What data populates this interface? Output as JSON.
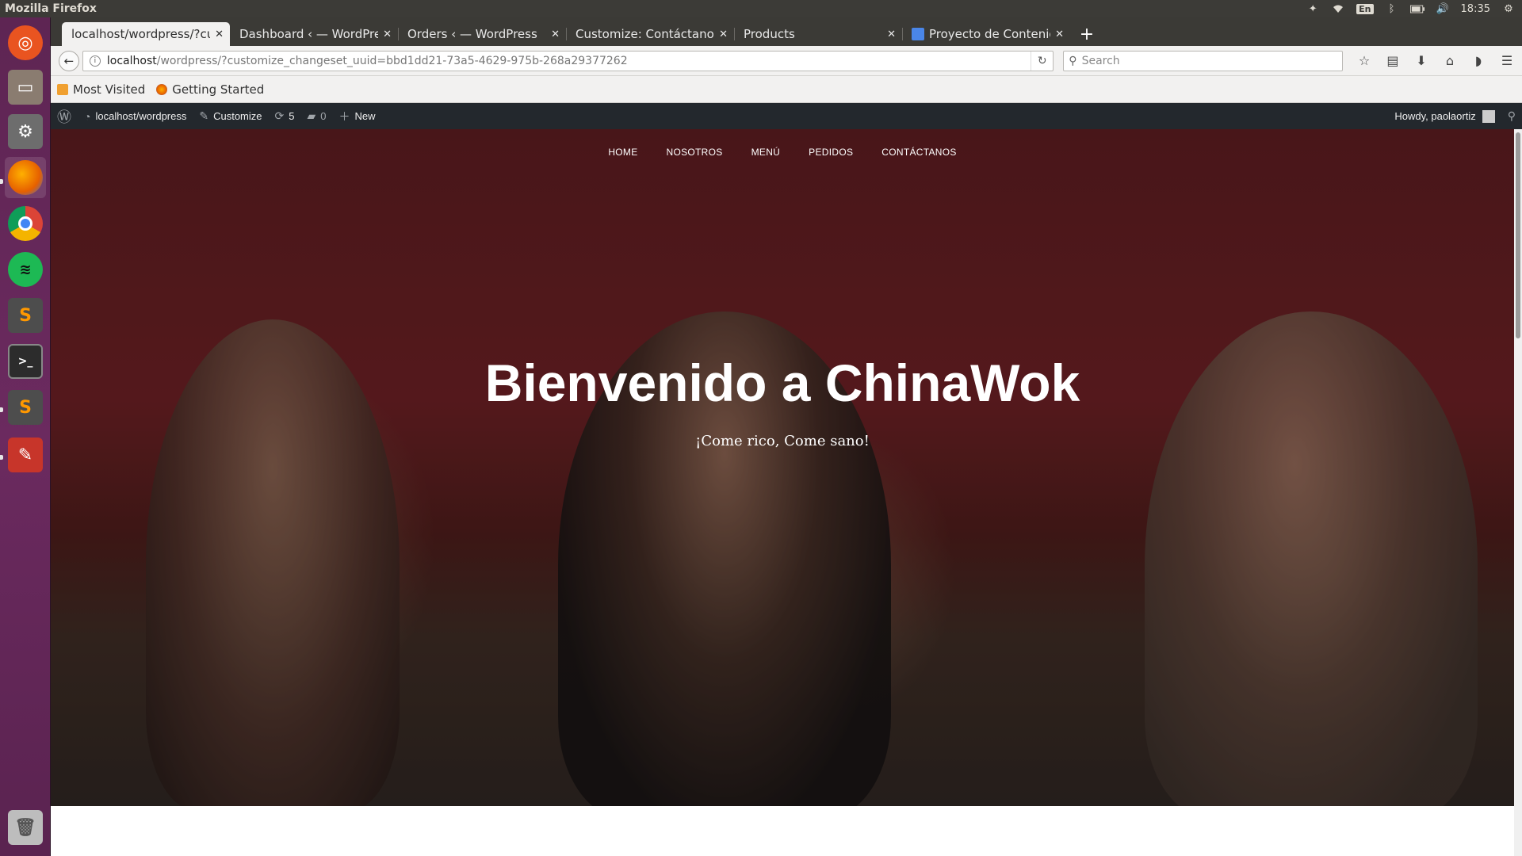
{
  "system": {
    "window_title": "Mozilla Firefox",
    "lang": "En",
    "clock": "18:35"
  },
  "launcher": {
    "apps": [
      {
        "name": "ubuntu-dash",
        "color": "#e95420"
      },
      {
        "name": "files",
        "color": "#8a7c70"
      },
      {
        "name": "system-settings",
        "color": "#6d6d6d"
      },
      {
        "name": "firefox",
        "color": "#e66000"
      },
      {
        "name": "chrome",
        "color": "#4285f4"
      },
      {
        "name": "spotify",
        "color": "#1db954"
      },
      {
        "name": "sublime-text",
        "color": "#4d4d4d"
      },
      {
        "name": "terminal",
        "color": "#2c2c2c"
      },
      {
        "name": "sublime-text-2",
        "color": "#4d4d4d"
      },
      {
        "name": "libreoffice-draw",
        "color": "#c7352a"
      },
      {
        "name": "trash",
        "color": "#aaaaaa"
      }
    ]
  },
  "tabs": [
    {
      "label": "localhost/wordpress/?cus",
      "active": true
    },
    {
      "label": "Dashboard ‹ — WordPress",
      "active": false
    },
    {
      "label": "Orders ‹ — WordPress",
      "active": false
    },
    {
      "label": "Customize: Contáctanos",
      "active": false
    },
    {
      "label": "Products",
      "active": false
    },
    {
      "label": "Proyecto de Contenido",
      "active": false
    }
  ],
  "nav": {
    "url_host": "localhost",
    "url_path": "/wordpress/?customize_changeset_uuid=bbd1dd21-73a5-4629-975b-268a29377262",
    "search_placeholder": "Search"
  },
  "bookmarks": [
    {
      "label": "Most Visited"
    },
    {
      "label": "Getting Started"
    }
  ],
  "wpbar": {
    "site": "localhost/wordpress",
    "customize": "Customize",
    "updates": "5",
    "comments": "0",
    "new": "New",
    "howdy": "Howdy, paolaortiz"
  },
  "hero": {
    "menu": [
      "HOME",
      "NOSOTROS",
      "MENÚ",
      "PEDIDOS",
      "CONTÁCTANOS"
    ],
    "title": "Bienvenido a ChinaWok",
    "subtitle": "¡Come rico, Come sano!"
  }
}
